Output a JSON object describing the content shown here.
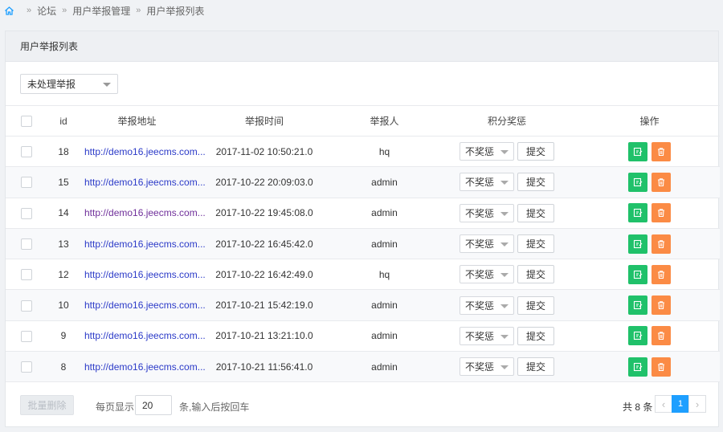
{
  "breadcrumb": [
    "论坛",
    "用户举报管理",
    "用户举报列表"
  ],
  "panel_title": "用户举报列表",
  "filter": {
    "selected": "未处理举报"
  },
  "columns": {
    "id": "id",
    "url": "举报地址",
    "time": "举报时间",
    "reporter": "举报人",
    "reward": "积分奖惩",
    "actions": "操作"
  },
  "rows": [
    {
      "id": "18",
      "url": "http://demo16.jeecms.com...",
      "time": "2017-11-02 10:50:21.0",
      "reporter": "hq",
      "reward": "不奖惩",
      "submit": "提交"
    },
    {
      "id": "15",
      "url": "http://demo16.jeecms.com...",
      "time": "2017-10-22 20:09:03.0",
      "reporter": "admin",
      "reward": "不奖惩",
      "submit": "提交"
    },
    {
      "id": "14",
      "url": "http://demo16.jeecms.com...",
      "time": "2017-10-22 19:45:08.0",
      "reporter": "admin",
      "reward": "不奖惩",
      "submit": "提交"
    },
    {
      "id": "13",
      "url": "http://demo16.jeecms.com...",
      "time": "2017-10-22 16:45:42.0",
      "reporter": "admin",
      "reward": "不奖惩",
      "submit": "提交"
    },
    {
      "id": "12",
      "url": "http://demo16.jeecms.com...",
      "time": "2017-10-22 16:42:49.0",
      "reporter": "hq",
      "reward": "不奖惩",
      "submit": "提交"
    },
    {
      "id": "10",
      "url": "http://demo16.jeecms.com...",
      "time": "2017-10-21 15:42:19.0",
      "reporter": "admin",
      "reward": "不奖惩",
      "submit": "提交"
    },
    {
      "id": "9",
      "url": "http://demo16.jeecms.com...",
      "time": "2017-10-21 13:21:10.0",
      "reporter": "admin",
      "reward": "不奖惩",
      "submit": "提交"
    },
    {
      "id": "8",
      "url": "http://demo16.jeecms.com...",
      "time": "2017-10-21 11:56:41.0",
      "reporter": "admin",
      "reward": "不奖惩",
      "submit": "提交"
    }
  ],
  "footer": {
    "batch_delete": "批量删除",
    "per_page_label": "每页显示",
    "per_page_value": "20",
    "per_page_hint": "条,输入后按回车",
    "total": "共 8 条",
    "current_page": "1"
  },
  "icons": {
    "home": "home-icon",
    "edit": "edit-icon",
    "delete": "trash-icon",
    "prev": "chevron-left-icon",
    "next": "chevron-right-icon"
  },
  "colors": {
    "link": "#2b3ac8",
    "link_visited": "#6f2f9a",
    "edit_button": "#20c16a",
    "delete_button": "#fb8b45",
    "pager_active": "#1e9fff"
  }
}
